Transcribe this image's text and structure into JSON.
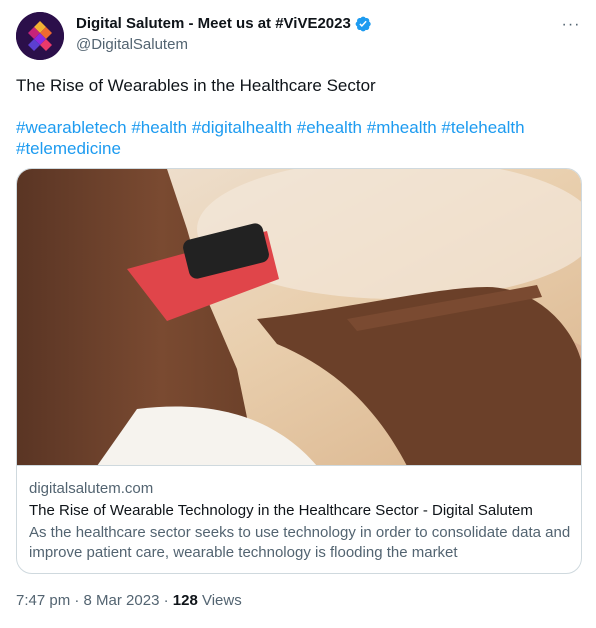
{
  "author": {
    "display_name": "Digital Salutem - Meet us at #ViVE2023",
    "handle": "@DigitalSalutem",
    "avatar_icon": "digital-salutem-logo",
    "verified_icon": "verified-badge-icon",
    "verified_color": "#1d9bf0"
  },
  "more_icon": "more-options-icon",
  "more_label": "···",
  "tweet": {
    "text": "The Rise of Wearables in the Healthcare Sector",
    "hashtags": [
      "#wearabletech",
      "#health",
      "#digitalhealth",
      "#ehealth",
      "#mhealth",
      "#telehealth",
      "#telemedicine"
    ]
  },
  "card": {
    "domain": "digitalsalutem.com",
    "title": "The Rise of Wearable Technology in the Healthcare Sector - Digital Salutem",
    "description": "As the healthcare sector seeks to use technology in order to consolidate data and improve patient care, wearable technology is flooding the market"
  },
  "meta": {
    "time": "7:47 pm",
    "separator": "·",
    "date": "8 Mar 2023",
    "views_count": "128",
    "views_label": "Views"
  },
  "colors": {
    "link": "#1d9bf0",
    "secondary_text": "#536471",
    "border": "#cfd9de"
  }
}
